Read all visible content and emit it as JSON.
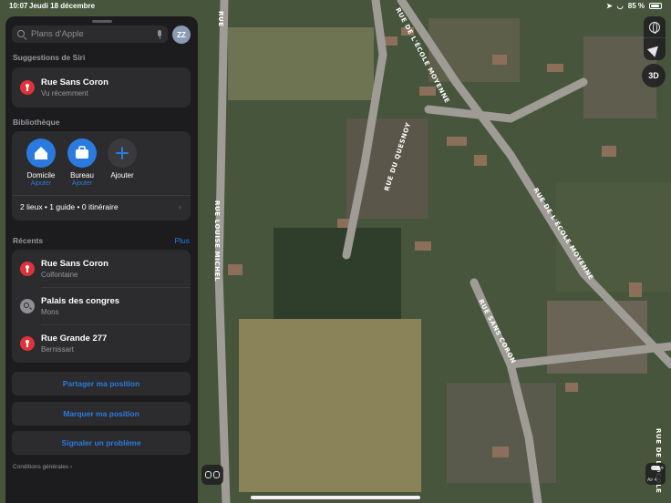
{
  "status_bar": {
    "time": "10:07",
    "date": "Jeudi 18 décembre",
    "battery_text": "85 %",
    "battery_level": 0.85
  },
  "search": {
    "placeholder": "Plans d'Apple"
  },
  "profile": {
    "initials": "ZZ"
  },
  "siri": {
    "title": "Suggestions de Siri",
    "item": {
      "name": "Rue Sans Coron",
      "subtitle": "Vu récemment"
    }
  },
  "library": {
    "title": "Bibliothèque",
    "items": [
      {
        "label": "Domicile",
        "sub": "Ajouter",
        "color": "#2b7ae0"
      },
      {
        "label": "Bureau",
        "sub": "Ajouter",
        "color": "#2b7ae0"
      },
      {
        "label": "Ajouter",
        "sub": "",
        "color": "#3a3a3c"
      }
    ],
    "summary": "2 lieux • 1 guide • 0 itinéraire"
  },
  "recents": {
    "title": "Récents",
    "more": "Plus",
    "items": [
      {
        "name": "Rue Sans Coron",
        "subtitle": "Colfontaine",
        "icon": "pin"
      },
      {
        "name": "Palais des congres",
        "subtitle": "Mons",
        "icon": "search"
      },
      {
        "name": "Rue Grande 277",
        "subtitle": "Bernissart",
        "icon": "pin"
      }
    ]
  },
  "actions": {
    "share": "Partager ma position",
    "mark": "Marquer ma position",
    "report": "Signaler un problème"
  },
  "footer": {
    "terms": "Conditions générales ›"
  },
  "map": {
    "view_button": "3D",
    "weather": {
      "temp": "9°",
      "air": "Air 4"
    },
    "road_labels": {
      "louise_michel": "RUE LOUISE MICHEL",
      "ecole_moyenne_top": "RUE DE L'ÉCOLE MOYENNE",
      "ecole_moyenne_mid": "RUE DE L'ÉCOLE MOYENNE",
      "quesnoy": "RUE DU QUESNOY",
      "sans_coron": "RUE SANS CORON",
      "edge_top": "RUE",
      "edge_bottom": "RUE DE L'ÉCOLE"
    }
  },
  "colors": {
    "accent": "#2b7ae0",
    "pin": "#e0323a",
    "panel": "#1c1c1e",
    "card": "#2c2c2e"
  }
}
